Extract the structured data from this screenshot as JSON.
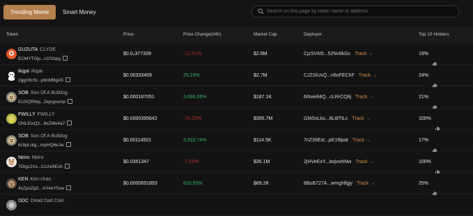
{
  "tabs": {
    "active": "Trending Meme",
    "other": "Smart Money"
  },
  "search": {
    "placeholder": "Search on this page by token name or address."
  },
  "columns": {
    "token": "Token",
    "price": "Price",
    "price_change": "Price Change(24h)",
    "market_cap": "Market Cap",
    "deployer": "Deployer",
    "holders": "Top 10 Holders"
  },
  "colors": {
    "accent": "#b5804d",
    "negative": "#b3322a",
    "positive": "#2fb36a",
    "track": "#d48b48"
  },
  "rows": [
    {
      "symbol": "GUZUTA",
      "name": "CLYDE",
      "address": "ECMYTGjv...n1f1bpg",
      "price": "$0.0₄377339",
      "change": "-21.51%",
      "change_dir": "neg",
      "mcap": "$2.6M",
      "deployer": "CjzSVkt5...52Nv6kGc",
      "track": "Track",
      "holders": "19%",
      "avatar_icon": "orange-circle-avatar-icon"
    },
    {
      "symbol": "ikigai",
      "name": "ikigai",
      "address": "2ggn9cSr...pbnMBgA5",
      "price": "$0.00333409",
      "change": "25.19%",
      "change_dir": "pos",
      "mcap": "$2.7M",
      "deployer": "CJZSiUxQ...n6oFEChF",
      "track": "Track",
      "holders": "24%",
      "avatar_icon": "white-ghost-avatar-icon"
    },
    {
      "symbol": "SOB",
      "name": "Son Of A Bulldog",
      "address": "EUXQR9oj...Dqxypump",
      "price": "$0.000187051",
      "change": "3,696.06%",
      "change_dir": "pos",
      "mcap": "$187.1K",
      "deployer": "6ihwe84Q...cLRrCQ9j",
      "track": "Track",
      "holders": "21%",
      "avatar_icon": "bulldog-avatar-icon"
    },
    {
      "symbol": "FWILLY",
      "name": "FWILLY",
      "address": "GNLEixQ2...8xZMo4a7",
      "price": "$0.0000395642",
      "change": "-76.32%",
      "change_dir": "neg",
      "mcap": "$395.7M",
      "deployer": "GfA5xLko...8Li8TtLc",
      "track": "Track",
      "holders": "100%",
      "avatar_icon": "yellow-frog-avatar-icon"
    },
    {
      "symbol": "SOB",
      "name": "Son Of A Bulldog",
      "address": "6UtpLrkg...mpHQ6eJw",
      "price": "$0.00114501",
      "change": "3,333.74%",
      "change_dir": "pos",
      "mcap": "$114.5K",
      "deployer": "7nZ36Ext...pE1f8pat",
      "track": "Track",
      "holders": "17%",
      "avatar_icon": "bulldog-avatar-icon"
    },
    {
      "symbol": "Neiro",
      "name": "Neiro",
      "address": "7Dtgc2Xv...CcXe9Exh",
      "price": "$0.0351347",
      "change": "-7.23%",
      "change_dir": "neg",
      "mcap": "$35.1M",
      "deployer": "2jHVeExY...bojvwhNw",
      "track": "Track",
      "holders": "100%",
      "avatar_icon": "dog-face-avatar-icon"
    },
    {
      "symbol": "KEN",
      "name": "Ken-chan",
      "address": "4cZpoZg3...XA4eY5xw",
      "price": "$0.0000691853",
      "change": "820.55%",
      "change_dir": "pos",
      "mcap": "$69.2K",
      "deployer": "8BuB727A...wmgNfgjy",
      "track": "Track",
      "holders": "25%",
      "avatar_icon": "dog-photo-avatar-icon"
    },
    {
      "symbol": "DDC",
      "name": "Dead Dad Coin",
      "address": "",
      "price": "",
      "change": "",
      "change_dir": "pos",
      "mcap": "",
      "deployer": "",
      "track": "",
      "holders": "",
      "avatar_icon": "grey-avatar-icon"
    }
  ]
}
